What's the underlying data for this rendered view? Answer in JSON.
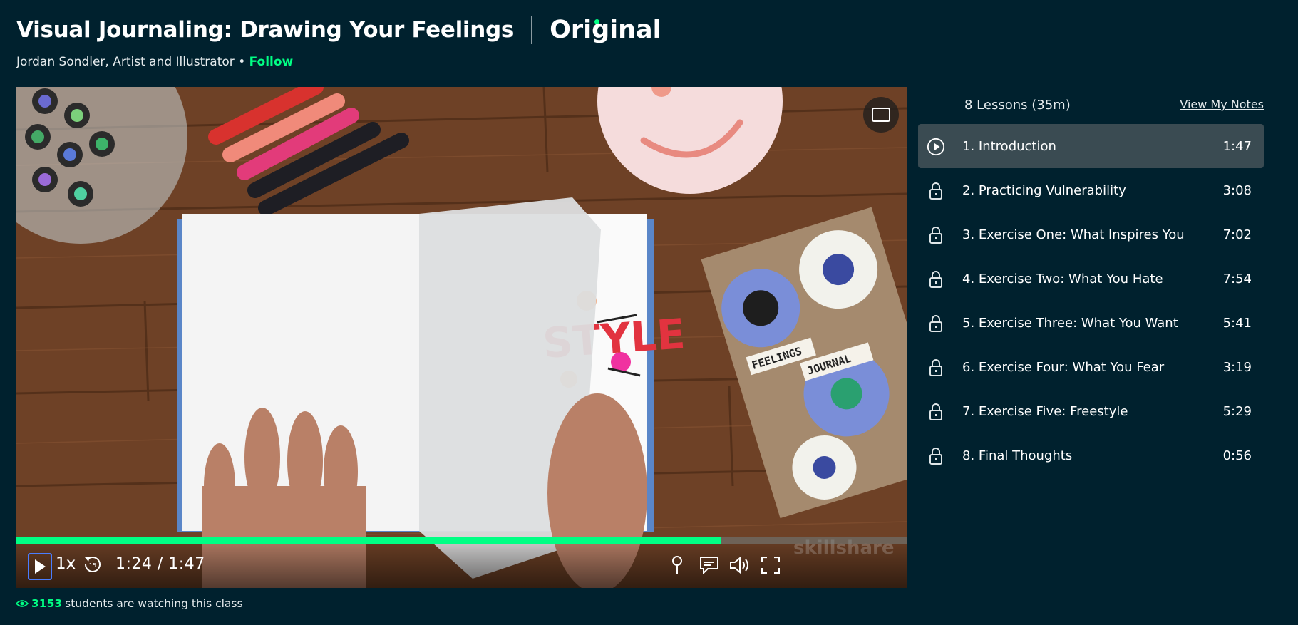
{
  "header": {
    "title": "Visual Journaling: Drawing Your Feelings",
    "badge": "Original",
    "teacher": "Jordan Sondler, Artist and Illustrator",
    "separator": "•",
    "follow_label": "Follow"
  },
  "player": {
    "speed_label": "1x",
    "replay_label": "15",
    "time_display": "1:24 / 1:47",
    "progress_fraction": 0.79,
    "accent_color": "#00ff84",
    "controls_icons": [
      "play-icon",
      "replay-15-icon",
      "pin-icon",
      "captions-icon",
      "volume-icon",
      "fullscreen-icon",
      "theater-mode-icon"
    ],
    "scene_text": {
      "page_word": "STYLE",
      "journal_line1": "FEELINGS",
      "journal_line2": "JOURNAL",
      "watermark": "skillshare"
    }
  },
  "watching": {
    "count": "3153",
    "text": "students are watching this class"
  },
  "sidebar": {
    "summary": "8 Lessons (35m)",
    "notes_link": "View My Notes",
    "lessons": [
      {
        "title": "1. Introduction",
        "duration": "1:47",
        "icon": "play-circle-icon"
      },
      {
        "title": "2. Practicing Vulnerability",
        "duration": "3:08",
        "icon": "lock-icon"
      },
      {
        "title": "3. Exercise One: What Inspires You",
        "duration": "7:02",
        "icon": "lock-icon"
      },
      {
        "title": "4. Exercise Two: What You Hate",
        "duration": "7:54",
        "icon": "lock-icon"
      },
      {
        "title": "5. Exercise Three: What You Want",
        "duration": "5:41",
        "icon": "lock-icon"
      },
      {
        "title": "6. Exercise Four: What You Fear",
        "duration": "3:19",
        "icon": "lock-icon"
      },
      {
        "title": "7. Exercise Five: Freestyle",
        "duration": "5:29",
        "icon": "lock-icon"
      },
      {
        "title": "8. Final Thoughts",
        "duration": "0:56",
        "icon": "lock-icon"
      }
    ]
  }
}
